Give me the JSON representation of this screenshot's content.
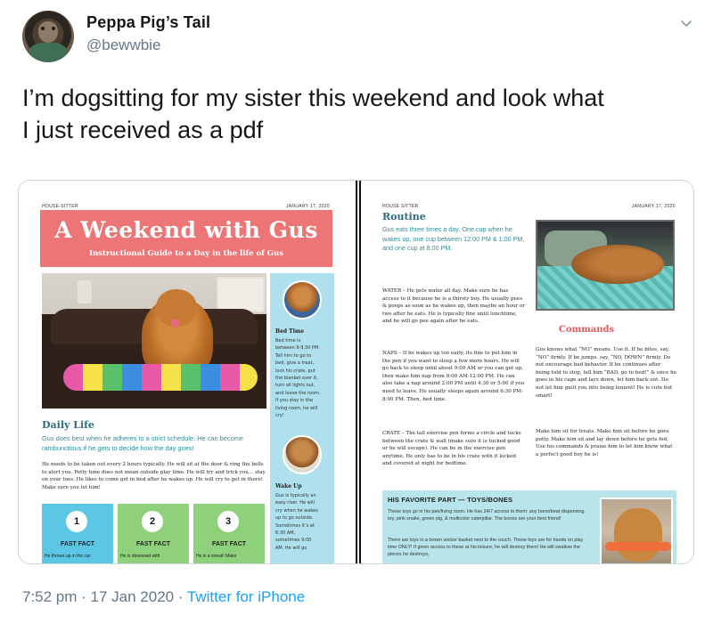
{
  "tweet": {
    "author_name": "Peppa Pig’s Tail",
    "author_handle": "@bewwbie",
    "text_line1": "I’m dogsitting for my sister this weekend and look what",
    "text_line2": "I just received as a pdf",
    "time": "7:52 pm · 17 Jan 2020 · ",
    "source": "Twitter for iPhone"
  },
  "doc_left": {
    "header_left": "HOUSE-SITTER",
    "header_right": "JANUARY 17, 2020",
    "title": "A Weekend with Gus",
    "subtitle": "Instructional Guide to a Day in the life of Gus",
    "bedtime_heading": "Bed Time",
    "bedtime_text": "Bed time is\nbetween 9-9:30 PM.\nTell him to go to\nbed, give a treat,\nlock his crate, put\nthe blanket over it,\nturn all lights out,\nand leave the room.\nIf you stay in the\nliving room, he will\ncry!",
    "wakeup_heading": "Wake Up",
    "wakeup_text": "Gus is typically an\neasy riser. He will\ncry when he wakes\nup to go outside.\nSometimes it’s at\n6:30 AM,\nsometimes 9:00\nAM. He will go",
    "daily_heading": "Daily Life",
    "daily_lead": "Gus does best when he adheres to a strict schedule. He can become rambunctious if he gets to decide how the day goes!",
    "daily_body": "He needs to be taken out every 2 hours typically. He will sit at the door & ring the bells to alert you. Potty time does not mean outside play time. He will try and trick you… stay on your toes. He likes to come get in bed after he wakes up. He will cry to get in there! Make sure you let him!",
    "facts": [
      {
        "num": "1",
        "label": "FAST FACT",
        "text": "He throws up in the car",
        "color": "#5cc6e5"
      },
      {
        "num": "2",
        "label": "FAST FACT",
        "text": "He is obsessed with",
        "color": "#8fd07a"
      },
      {
        "num": "3",
        "label": "FAST FACT",
        "text": "He is a sneak! Make",
        "color": "#8fd07a"
      }
    ]
  },
  "doc_right": {
    "header_left": "HOUSE SITTER",
    "header_right": "JANUARY 17, 2020",
    "routine_heading": "Routine",
    "routine_lead": "Gus eats three times a day. One cup when he wakes up, one cup between 12:00 PM & 1:00 PM, and one cup at 8:00 PM.",
    "water_text": "WATER – He gets water all day. Make sure he has access to it because he is a thirsty boy. He usually pees & poops as soon as he wakes up, then maybe an hour or two after he eats. He is typically fine until lunchtime, and he will go pee again after he eats.",
    "naps_text": "NAPS – If he wakes up too early, its fine to put him in the pen if you want to sleep a few more hours. He will go back to sleep until about 9:00 AM or you can get up, then make him nap from 9:00 AM-12:00 PM. He can also take a nap around 2:00 PM until 4:30 or 5:00 if you need to leave. He usually sleeps again around 6:30 PM-8:00 PM. Then, bed time.",
    "crate_text": "CRATE – The tall exercise pen forms a circle and tucks between the crate & wall (make sure it is tucked good or he will escape). He can be in the exercise pen anytime. He only has to be in his crate with it locked and covered at night for bedtime.",
    "commands_heading": "Commands",
    "commands_text1": "Gus knows what “NO” means. Use it. If he bites, say, “NO” firmly. If be jumps, say, “NO, DOWN” firmly. Do not encourage bad behavior. If be continues after being told to stop, tell him “BAD, go to bed!” & once he goes in his cage and lays down, let him back out. Do not let him guilt you into being lenient! He is cute but smart!",
    "commands_text2": "Make him sit for treats. Make him sit before he goes potty. Make him sit and lay down before he gets fed. Use his commands & praise him to let him know what a perfect good boy he is!",
    "fav_title": "HIS FAVORITE PART — TOYS/BONES",
    "fav_text1": "These toys go in his pen/living room. He has 24/7 access to them: any bone/treat dispensing toy, pink snake, green pig, & multicolor caterpillar. The bones are your best friend!",
    "fav_text2": "There are toys in a brown wicker basket next to the couch. Those toys are for hands on play time ONLY! If given access to these at his leisure, he will destroy them! He will swallow the pieces he destroys,"
  },
  "colors": {
    "hero_red": "#ee7576",
    "side_blue": "#aee0ee",
    "teal_text": "#2f8e98",
    "commands_red": "#e0595f",
    "twitter_blue": "#1da1f2"
  }
}
